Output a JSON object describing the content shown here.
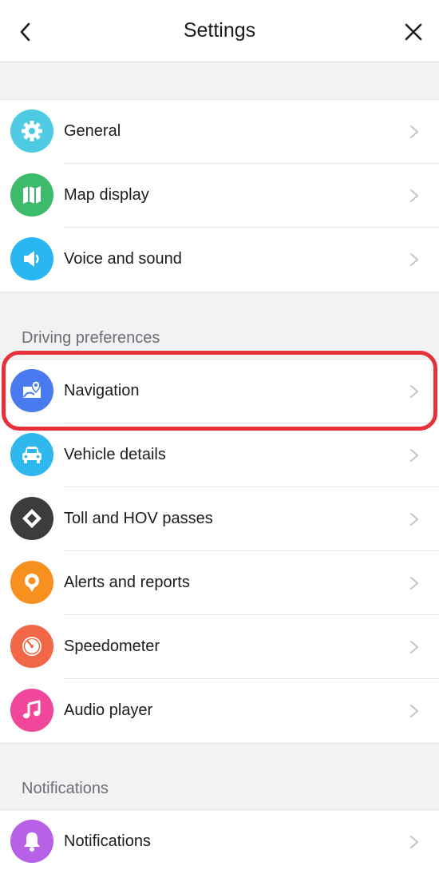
{
  "header": {
    "title": "Settings"
  },
  "groups": {
    "main": [
      {
        "label": "General",
        "icon": "gear-icon",
        "color": "#4ecbe3"
      },
      {
        "label": "Map display",
        "icon": "map-icon",
        "color": "#3dbb6c"
      },
      {
        "label": "Voice and sound",
        "icon": "speaker-icon",
        "color": "#29b6f0"
      }
    ],
    "driving": [
      {
        "label": "Navigation",
        "icon": "navigation-icon",
        "color": "#4a7af0"
      },
      {
        "label": "Vehicle details",
        "icon": "car-icon",
        "color": "#2fb8ee"
      },
      {
        "label": "Toll and HOV passes",
        "icon": "diamond-icon",
        "color": "#3c3c3e"
      },
      {
        "label": "Alerts and reports",
        "icon": "alert-pin-icon",
        "color": "#f7901e"
      },
      {
        "label": "Speedometer",
        "icon": "speedometer-icon",
        "color": "#f26745"
      },
      {
        "label": "Audio player",
        "icon": "music-note-icon",
        "color": "#f0479a"
      }
    ],
    "notifications": [
      {
        "label": "Notifications",
        "icon": "bell-icon",
        "color": "#b762e6"
      }
    ]
  },
  "sections": {
    "driving_title": "Driving preferences",
    "notifications_title": "Notifications"
  },
  "highlight": {
    "target": "Navigation",
    "color": "#e8303a"
  }
}
